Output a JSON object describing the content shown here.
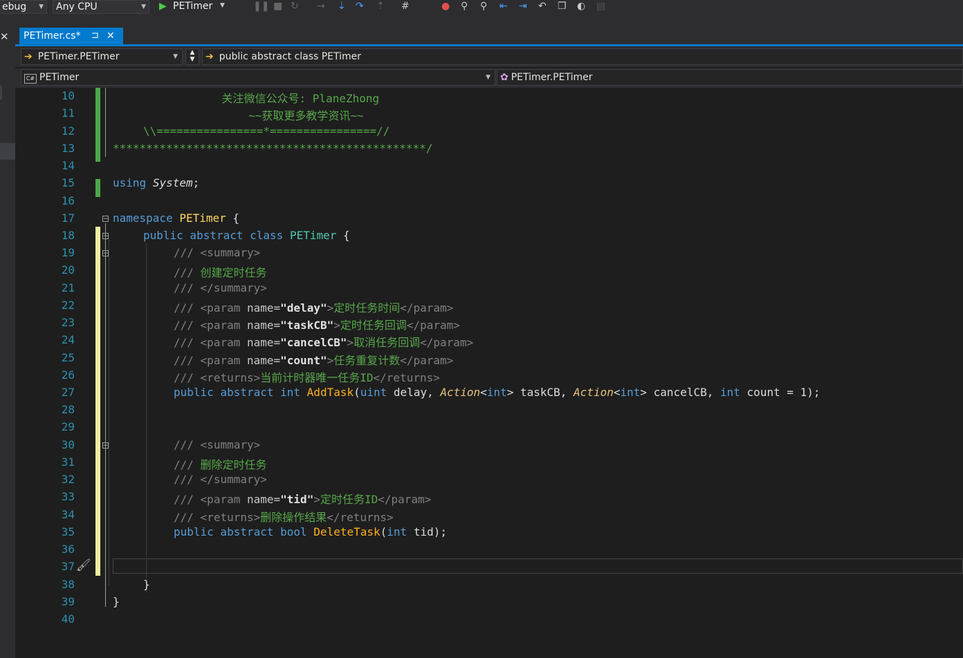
{
  "toolbar": {
    "config": "ebug",
    "platform": "Any CPU",
    "start_target": "PETimer"
  },
  "tab": {
    "label": "PETimer.cs*",
    "pin": "⊐",
    "close": "✕"
  },
  "nav": {
    "type_scope": "PETimer.PETimer",
    "member_scope": "public abstract class PETimer",
    "project": "PETimer",
    "class_scope": "PETimer.PETimer"
  },
  "gutter": {
    "line_numbers": [
      "10",
      "11",
      "12",
      "13",
      "14",
      "15",
      "16",
      "17",
      "18",
      "19",
      "20",
      "21",
      "22",
      "23",
      "24",
      "25",
      "26",
      "27",
      "28",
      "29",
      "30",
      "31",
      "32",
      "33",
      "34",
      "35",
      "36",
      "37",
      "38",
      "39",
      "40"
    ]
  },
  "code": {
    "l10": "    关注微信公众号: PlaneZhong",
    "l11": "        ~~获取更多教学资讯~~",
    "l12": "\\\\================*================//",
    "l13": "***********************************************/",
    "l15_kw": "using",
    "l15_ns": "System",
    "l17_kw": "namespace",
    "l17_name": "PETimer",
    "l18_mods": "public abstract class",
    "l18_name": "PETimer",
    "doc_prefix": "///",
    "l19": "<summary>",
    "l20": "创建定时任务",
    "l21": "</summary>",
    "l22_name": "\"delay\"",
    "l22_text": "定时任务时间",
    "l23_name": "\"taskCB\"",
    "l23_text": "定时任务回调",
    "l24_name": "\"cancelCB\"",
    "l24_text": "取消任务回调",
    "l25_name": "\"count\"",
    "l25_text": "任务重复计数",
    "l26_text": "当前计时器唯一任务ID",
    "l27_mods": "public abstract int",
    "l27_fn": "AddTask",
    "l27_p1type": "uint",
    "l27_p1": "delay,",
    "l27_action": "Action",
    "l27_int": "int",
    "l27_p2": "taskCB,",
    "l27_p3": "cancelCB,",
    "l27_p4": "count = 1);",
    "l30": "<summary>",
    "l31": "删除定时任务",
    "l32": "</summary>",
    "l33_name": "\"tid\"",
    "l33_text": "定时任务ID",
    "l34_text": "删除操作结果",
    "l35_mods": "public abstract bool",
    "l35_fn": "DeleteTask",
    "l35_ptype": "int",
    "l35_p": "tid);"
  }
}
